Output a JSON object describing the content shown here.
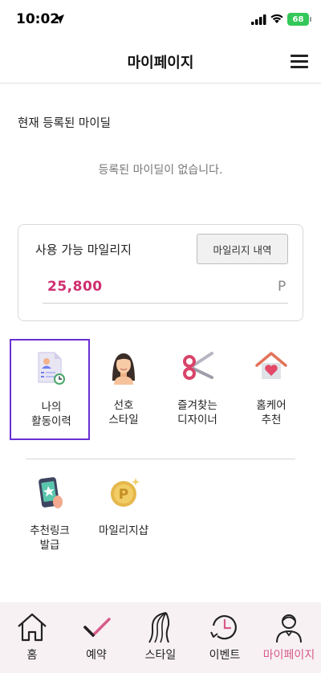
{
  "status_bar": {
    "time": "10:02",
    "battery": "68"
  },
  "header": {
    "title": "마이페이지"
  },
  "mydeal": {
    "section_title": "현재 등록된 마이딜",
    "empty_message": "등록된 마이딜이 없습니다."
  },
  "mileage": {
    "label": "사용 가능 마일리지",
    "history_button": "마일리지 내역",
    "amount": "25,800",
    "unit": "P"
  },
  "menu": {
    "activity_line1": "나의",
    "activity_line2": "활동이력",
    "style_line1": "선호",
    "style_line2": "스타일",
    "designer_line1": "즐겨찾는",
    "designer_line2": "디자이너",
    "homecare_line1": "홈케어",
    "homecare_line2": "추천",
    "referral_line1": "추천링크",
    "referral_line2": "발급",
    "mileage_shop": "마일리지샵"
  },
  "tabs": {
    "home": "홈",
    "reservation": "예약",
    "style": "스타일",
    "event": "이벤트",
    "mypage": "마이페이지"
  },
  "colors": {
    "accent_pink": "#d75a8a",
    "amount_pink": "#cf2e6f",
    "selection_purple": "#6a2fd3",
    "tabbar_bg": "#f7f1f4"
  },
  "icons": {
    "activity": "document-clock-icon",
    "style": "woman-face-icon",
    "designer": "scissors-icon",
    "homecare": "house-heart-icon",
    "referral": "phone-star-icon",
    "mileage_shop": "p-coin-icon"
  }
}
